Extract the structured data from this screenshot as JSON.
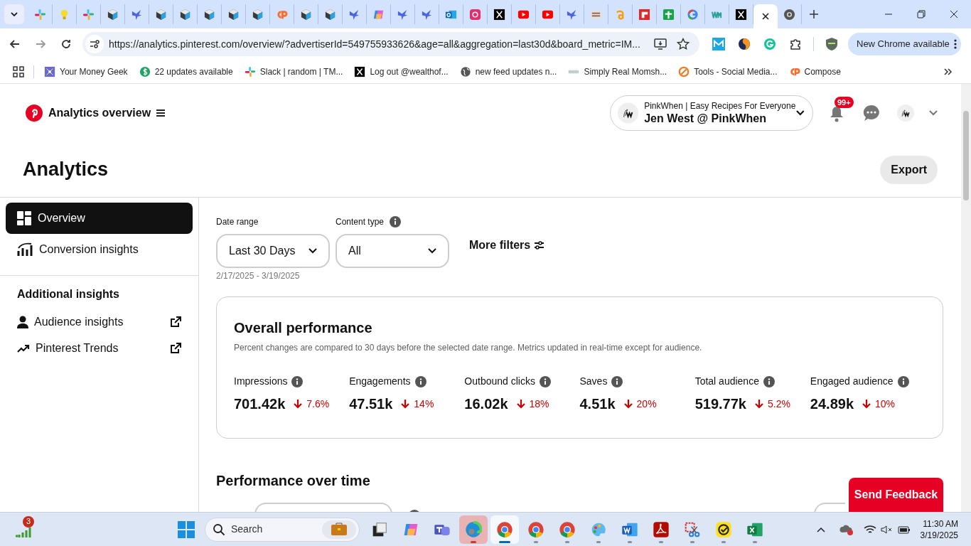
{
  "browser": {
    "tabs": [
      {
        "kind": "slack",
        "selected": false
      },
      {
        "kind": "bulb",
        "selected": false
      },
      {
        "kind": "slack",
        "selected": false
      },
      {
        "kind": "cube",
        "selected": false
      },
      {
        "kind": "bird",
        "selected": false
      },
      {
        "kind": "cube",
        "selected": false
      },
      {
        "kind": "cube",
        "selected": false
      },
      {
        "kind": "cube",
        "selected": false
      },
      {
        "kind": "cube",
        "selected": false
      },
      {
        "kind": "cube",
        "selected": false
      },
      {
        "kind": "cp",
        "selected": false
      },
      {
        "kind": "cube",
        "selected": false
      },
      {
        "kind": "cube",
        "selected": false
      },
      {
        "kind": "bird",
        "selected": false
      },
      {
        "kind": "copilot",
        "selected": false
      },
      {
        "kind": "bird",
        "selected": false
      },
      {
        "kind": "bird",
        "selected": false
      },
      {
        "kind": "outlook",
        "selected": false
      },
      {
        "kind": "instagram",
        "selected": false
      },
      {
        "kind": "x",
        "selected": false
      },
      {
        "kind": "youtube",
        "selected": false
      },
      {
        "kind": "youtube",
        "selected": false
      },
      {
        "kind": "bird",
        "selected": false
      },
      {
        "kind": "stamp",
        "selected": false
      },
      {
        "kind": "amazon",
        "selected": false
      },
      {
        "kind": "flipboard",
        "selected": false
      },
      {
        "kind": "sheets",
        "selected": false
      },
      {
        "kind": "google",
        "selected": false
      },
      {
        "kind": "wm",
        "selected": false
      },
      {
        "kind": "x",
        "selected": false
      },
      {
        "kind": "blank",
        "selected": true
      },
      {
        "kind": "chrome",
        "selected": false
      }
    ],
    "url": "https://analytics.pinterest.com/overview/?advertiserId=549755933626&age=all&aggregation=last30d&board_metric=IM...",
    "update_button": "New Chrome available",
    "bookmarks": [
      {
        "kind": "geek",
        "label": "Your Money Geek"
      },
      {
        "kind": "dollar",
        "label": "22 updates available"
      },
      {
        "kind": "slack",
        "label": "Slack | random | TM..."
      },
      {
        "kind": "x",
        "label": "Log out @wealthof..."
      },
      {
        "kind": "globe",
        "label": "new feed updates n..."
      },
      {
        "kind": "lines",
        "label": "Simply Real Momsh..."
      },
      {
        "kind": "tools",
        "label": "Tools - Social Media..."
      },
      {
        "kind": "cp",
        "label": "Compose"
      }
    ]
  },
  "header": {
    "title": "Analytics overview",
    "account": {
      "business": "PinkWhen | Easy Recipes For Everyone",
      "name": "Jen West @ PinkWhen"
    },
    "notification_count": "99+"
  },
  "page_title": "Analytics",
  "export_button": "Export",
  "sidebar": {
    "items": [
      {
        "kind": "overview",
        "label": "Overview",
        "selected": true
      },
      {
        "kind": "conversion",
        "label": "Conversion insights",
        "selected": false
      }
    ],
    "section_title": "Additional insights",
    "links": [
      {
        "kind": "audience",
        "label": "Audience insights"
      },
      {
        "kind": "trends",
        "label": "Pinterest Trends"
      }
    ]
  },
  "filters": {
    "date_range": {
      "label": "Date range",
      "value": "Last 30 Days",
      "dates": "2/17/2025 - 3/19/2025"
    },
    "content_type": {
      "label": "Content type",
      "value": "All"
    },
    "more_filters": "More filters"
  },
  "overall_performance": {
    "title": "Overall performance",
    "note": "Percent changes are compared to 30 days before the selected date range. Metrics updated in real-time except for audience.",
    "metrics": [
      {
        "name": "Impressions",
        "value": "701.42k",
        "change": "7.6%",
        "kind": "decrease"
      },
      {
        "name": "Engagements",
        "value": "47.51k",
        "change": "14%",
        "kind": "decrease"
      },
      {
        "name": "Outbound clicks",
        "value": "16.02k",
        "change": "18%",
        "kind": "decrease"
      },
      {
        "name": "Saves",
        "value": "4.51k",
        "change": "20%",
        "kind": "decrease"
      },
      {
        "name": "Total audience",
        "value": "519.77k",
        "change": "5.2%",
        "kind": "decrease"
      },
      {
        "name": "Engaged audience",
        "value": "24.89k",
        "change": "10%",
        "kind": "decrease"
      }
    ]
  },
  "performance_over_time": {
    "title": "Performance over time"
  },
  "feedback_button": "Send Feedback",
  "taskbar": {
    "widget_badge": "3",
    "search_placeholder": "Search",
    "apps": [
      {
        "kind": "taskview",
        "open": false,
        "active": false,
        "attention": false
      },
      {
        "kind": "copilot",
        "open": false,
        "active": false,
        "attention": false
      },
      {
        "kind": "teams",
        "open": false,
        "active": false,
        "attention": false
      },
      {
        "kind": "edge",
        "open": true,
        "active": false,
        "attention": true
      },
      {
        "kind": "chrome",
        "open": true,
        "active": true,
        "attention": false
      },
      {
        "kind": "chrome",
        "open": true,
        "active": false,
        "attention": false
      },
      {
        "kind": "chrome",
        "open": true,
        "active": false,
        "attention": false
      },
      {
        "kind": "paint",
        "open": true,
        "active": false,
        "attention": false
      },
      {
        "kind": "word",
        "open": true,
        "active": false,
        "attention": false
      },
      {
        "kind": "acrobat",
        "open": true,
        "active": false,
        "attention": false
      },
      {
        "kind": "snip",
        "open": true,
        "active": false,
        "attention": false
      },
      {
        "kind": "norton",
        "open": true,
        "active": false,
        "attention": false
      },
      {
        "kind": "excel",
        "open": true,
        "active": false,
        "attention": false
      }
    ],
    "time": "11:30 AM",
    "date": "3/19/2025"
  }
}
